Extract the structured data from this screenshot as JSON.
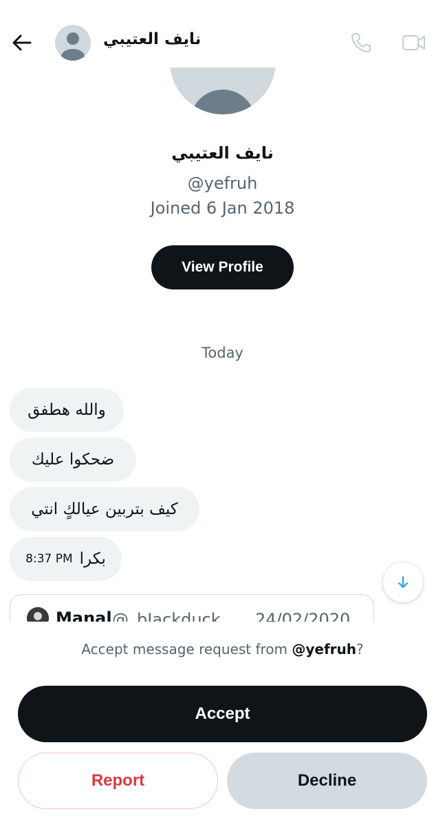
{
  "header": {
    "title": "نايف العتيبي",
    "back_icon": "back-arrow-icon",
    "call_icon": "phone-icon",
    "video_icon": "video-camera-icon"
  },
  "profile": {
    "name": "نايف العتيبي",
    "handle": "@yefruh",
    "joined": "Joined 6 Jan 2018",
    "view_profile_label": "View Profile"
  },
  "conversation": {
    "day_label": "Today",
    "messages": [
      {
        "text": "والله هطفق",
        "time": ""
      },
      {
        "text": "ضحكوا عليك",
        "time": ""
      },
      {
        "text": "كيف بتربين عيالكٍ انتي",
        "time": ""
      },
      {
        "text": "بكرا",
        "time": "8:37 PM"
      }
    ],
    "quoted_post": {
      "author": "Manal",
      "handle": "@_bIackduck",
      "date": "24/02/2020"
    }
  },
  "request": {
    "prefix": "Accept message request from ",
    "handle": "@yefruh",
    "suffix": "?",
    "accept_label": "Accept",
    "report_label": "Report",
    "decline_label": "Decline"
  },
  "colors": {
    "primary": "#0f1419",
    "secondary_text": "#536471",
    "bubble": "#eff3f4",
    "danger": "#d83a3f",
    "decline_bg": "#d4dbe0",
    "accent": "#1d9bf0"
  }
}
